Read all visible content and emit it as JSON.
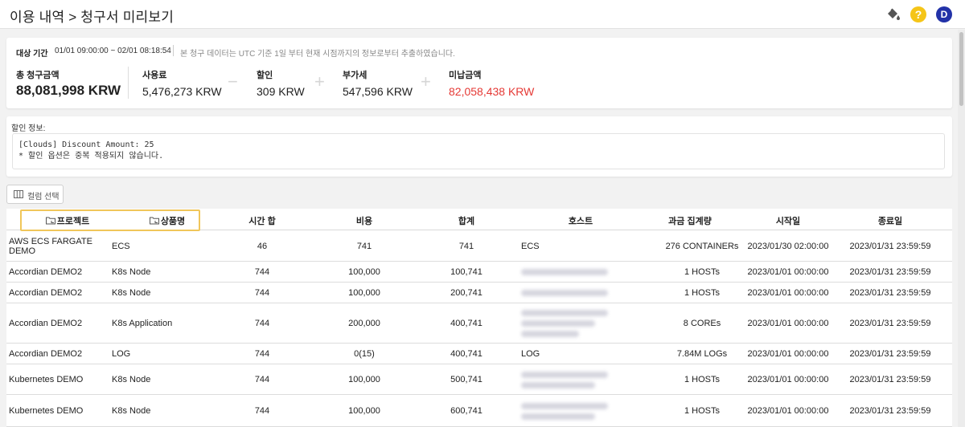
{
  "header": {
    "title": "이용 내역 > 청구서 미리보기",
    "help_icon_label": "?",
    "avatar_initial": "D"
  },
  "summary": {
    "period_label": "대상 기간",
    "period_range": "01/01 09:00:00 ~ 02/01 08:18:54",
    "period_note": "본 청구 데이터는 UTC 기준 1일 부터 현재 시점까지의 정보로부터 추출하였습니다.",
    "total_label": "총 청구금액",
    "total_value": "88,081,998 KRW",
    "usage_label": "사용료",
    "usage_value": "5,476,273 KRW",
    "op_minus": "−",
    "discount_label": "할인",
    "discount_value": "309 KRW",
    "op_plus": "+",
    "vat_label": "부가세",
    "vat_value": "547,596 KRW",
    "unpaid_label": "미납금액",
    "unpaid_value": "82,058,438 KRW",
    "unpaid_color": "#e53935"
  },
  "discount_info": {
    "label": "할인 정보:",
    "line1": "[Clouds] Discount Amount: 25",
    "line2": "* 할인 옵션은 중복 적용되지 않습니다."
  },
  "column_button": {
    "label": "컬럼 선택",
    "icon": "columns-icon"
  },
  "table": {
    "headers": {
      "project": "프로젝트",
      "product": "상품명",
      "hours": "시간 합",
      "cost": "비용",
      "sum": "합계",
      "host": "호스트",
      "agg": "과금 집계량",
      "start": "시작일",
      "end": "종료일"
    },
    "highlight_color": "#f0c65a",
    "rows": [
      {
        "project": "AWS ECS FARGATE DEMO",
        "product": "ECS",
        "hours": "46",
        "cost": "741",
        "sum": "741",
        "host": "ECS",
        "agg": "276 CONTAINERs",
        "start": "2023/01/30 02:00:00",
        "end": "2023/01/31 23:59:59"
      },
      {
        "project": "Accordian DEMO2",
        "product": "K8s Node",
        "hours": "744",
        "cost": "100,000",
        "sum": "100,741",
        "host": "",
        "agg": "1 HOSTs",
        "start": "2023/01/01 00:00:00",
        "end": "2023/01/31 23:59:59"
      },
      {
        "project": "Accordian DEMO2",
        "product": "K8s Node",
        "hours": "744",
        "cost": "100,000",
        "sum": "200,741",
        "host": "",
        "agg": "1 HOSTs",
        "start": "2023/01/01 00:00:00",
        "end": "2023/01/31 23:59:59"
      },
      {
        "project": "Accordian DEMO2",
        "product": "K8s Application",
        "hours": "744",
        "cost": "200,000",
        "sum": "400,741",
        "host": "",
        "agg": "8 COREs",
        "start": "2023/01/01 00:00:00",
        "end": "2023/01/31 23:59:59"
      },
      {
        "project": "Accordian DEMO2",
        "product": "LOG",
        "hours": "744",
        "cost": "0(15)",
        "sum": "400,741",
        "host": "LOG",
        "agg": "7.84M LOGs",
        "start": "2023/01/01 00:00:00",
        "end": "2023/01/31 23:59:59"
      },
      {
        "project": "Kubernetes DEMO",
        "product": "K8s Node",
        "hours": "744",
        "cost": "100,000",
        "sum": "500,741",
        "host": "",
        "agg": "1 HOSTs",
        "start": "2023/01/01 00:00:00",
        "end": "2023/01/31 23:59:59"
      },
      {
        "project": "Kubernetes DEMO",
        "product": "K8s Node",
        "hours": "744",
        "cost": "100,000",
        "sum": "600,741",
        "host": "",
        "agg": "1 HOSTs",
        "start": "2023/01/01 00:00:00",
        "end": "2023/01/31 23:59:59"
      }
    ]
  }
}
